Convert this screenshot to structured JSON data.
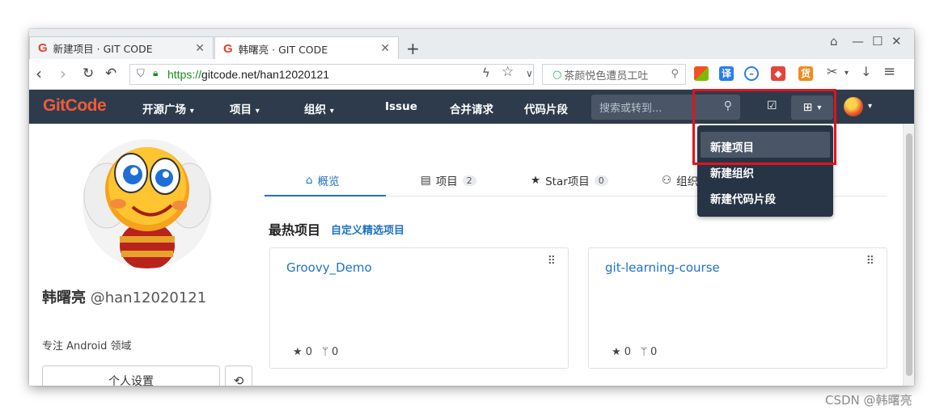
{
  "browser": {
    "tabs": [
      {
        "title": "新建项目 · GIT CODE",
        "icon": "gitcode-g-icon"
      },
      {
        "title": "韩曙亮 · GIT CODE",
        "icon": "gitcode-g-icon"
      }
    ],
    "new_tab": "+",
    "controls": {
      "pin": "⌂",
      "minimize": "—",
      "maximize": "☐",
      "close": "✕"
    },
    "url_proto": "https://",
    "url_rest": "gitcode.net/han12020121",
    "search_engine_text": "茶颜悦色遭员工吐"
  },
  "gitcode_nav": {
    "logo": "GitCode",
    "items": [
      "开源广场",
      "项目",
      "组织",
      "Issue",
      "合并请求",
      "代码片段"
    ],
    "search_placeholder": "搜索或转到..."
  },
  "dropdown": {
    "items": [
      "新建项目",
      "新建组织",
      "新建代码片段"
    ]
  },
  "profile": {
    "name": "韩曙亮",
    "handle": "@han12020121",
    "bio": "专注 Android 领域",
    "settings_button": "个人设置"
  },
  "profile_tabs": [
    {
      "label": "概览",
      "count": null
    },
    {
      "label": "项目",
      "count": "2"
    },
    {
      "label": "Star项目",
      "count": "0"
    },
    {
      "label": "组织",
      "count": null
    }
  ],
  "hot_projects": {
    "title": "最热项目",
    "customize_link": "自定义精选项目",
    "cards": [
      {
        "name": "Groovy_Demo",
        "stars": "0",
        "forks": "0"
      },
      {
        "name": "git-learning-course",
        "stars": "0",
        "forks": "0"
      }
    ]
  },
  "watermark": "CSDN @韩曙亮",
  "colors": {
    "nav_bg": "#2e3b4c",
    "accent": "#1f72c6",
    "logo": "#f05a3a",
    "highlight_box": "#e5121b"
  }
}
